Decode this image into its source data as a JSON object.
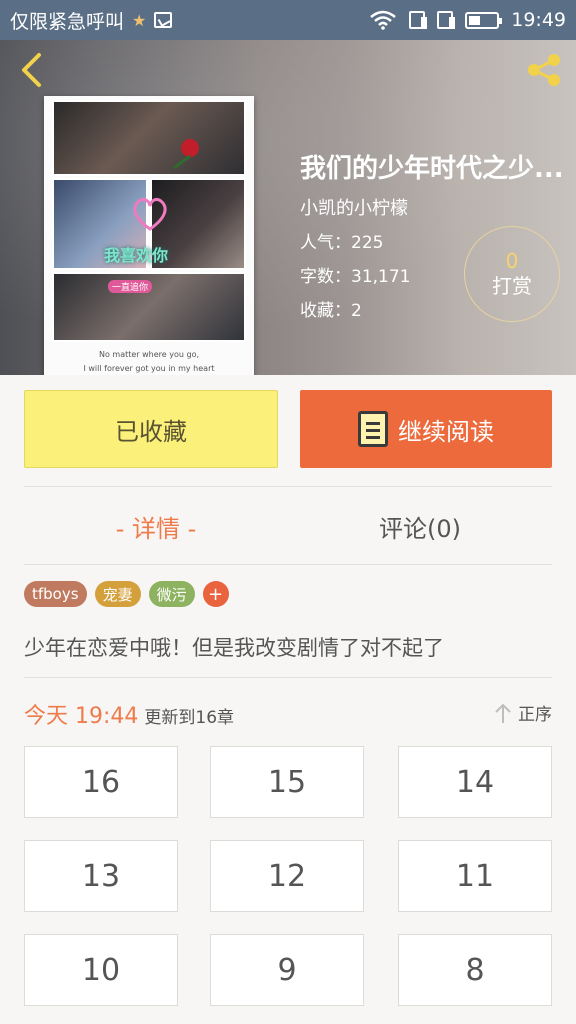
{
  "statusbar": {
    "app_name": "仅限紧急呼叫",
    "time": "19:49"
  },
  "header": {
    "title": "我们的少年时代之少...",
    "author": "小凯的小柠檬",
    "popularity_label": "人气：",
    "popularity": "225",
    "words_label": "字数：",
    "words": "31,171",
    "favorites_label": "收藏：",
    "favorites": "2",
    "reward_count": "0",
    "reward_label": "打赏",
    "cover_caption_1": "No matter where you go,",
    "cover_caption_2": "I will forever got you in my heart",
    "cover_text": "我喜欢你",
    "cover_tag": "一直追你"
  },
  "actions": {
    "favorite_label": "已收藏",
    "read_label": "继续阅读"
  },
  "tabs": {
    "detail": "- 详情 -",
    "comments": "评论(0)"
  },
  "tags": [
    {
      "label": "tfboys",
      "color": "#c07a5f"
    },
    {
      "label": "宠妻",
      "color": "#d4a03c"
    },
    {
      "label": "微污",
      "color": "#8eb360"
    }
  ],
  "tag_add": "+",
  "description": "少年在恋爱中哦！但是我改变剧情了对不起了",
  "update": {
    "time": "今天 19:44",
    "text": "更新到16章",
    "sort_label": "正序"
  },
  "chapters": [
    "16",
    "15",
    "14",
    "13",
    "12",
    "11",
    "10",
    "9",
    "8"
  ],
  "colors": {
    "accent": "#ee7b4b",
    "favorite_bg": "#fbf07a",
    "read_bg": "#ec6a3c"
  }
}
